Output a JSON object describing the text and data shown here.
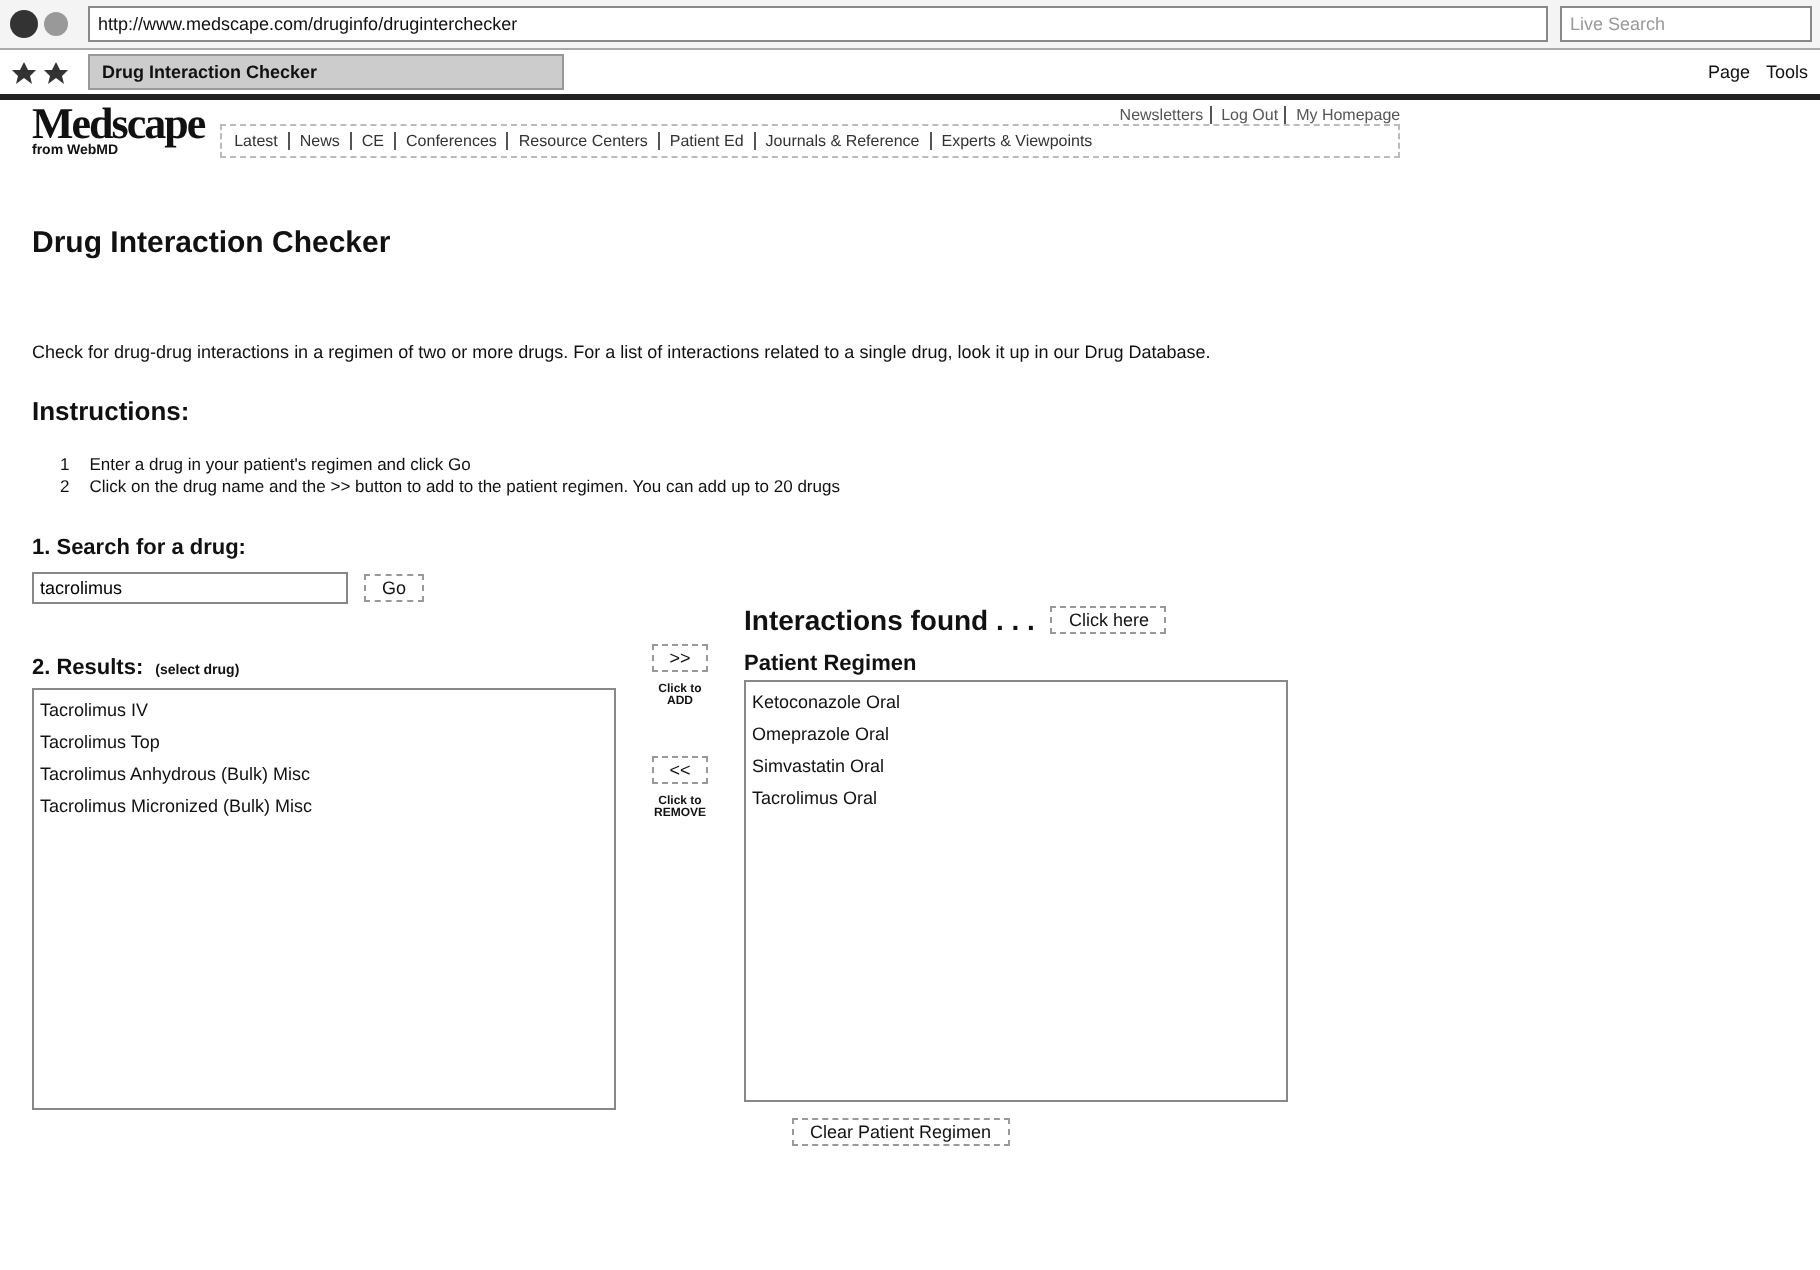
{
  "browser": {
    "address": "http://www.medscape.com/druginfo/druginterchecker",
    "search_placeholder": "Live Search",
    "tab_title": "Drug Interaction Checker",
    "toolbar": [
      "Page",
      "Tools"
    ]
  },
  "header": {
    "logo": "Medscape",
    "logo_sub": "from WebMD",
    "top_links": [
      "Newsletters",
      "Log Out",
      "My Homepage"
    ],
    "nav": [
      "Latest",
      "News",
      "CE",
      "Conferences",
      "Resource Centers",
      "Patient Ed",
      "Journals & Reference",
      "Experts & Viewpoints"
    ]
  },
  "title": "Drug Interaction Checker",
  "intro": "Check for drug-drug interactions in a regimen of two or more drugs. For a list of interactions related to a single drug, look it up in our Drug Database.",
  "instructions_heading": "Instructions:",
  "instructions": [
    {
      "number": "1",
      "text": "Enter a drug in your patient's regimen and click Go"
    },
    {
      "number": "2",
      "text": "Click on the drug name and the >> button to add to the patient regimen. You can add up to 20 drugs"
    }
  ],
  "search": {
    "label": "1. Search for a drug:",
    "value": "tacrolimus",
    "button": "Go"
  },
  "interactions": {
    "label": "Interactions found . . .",
    "button": "Click here"
  },
  "results": {
    "label": "2. Results:",
    "hint": "(select drug)",
    "items": [
      {
        "text": "Tacrolimus IV",
        "selected": false
      },
      {
        "text": "Tacrolimus Top",
        "selected": false
      },
      {
        "text": "Tacrolimus Anhydrous (Bulk) Misc",
        "selected": false
      },
      {
        "text": "Tacrolimus Micronized (Bulk) Misc",
        "selected": false
      }
    ]
  },
  "add": {
    "button": ">>",
    "caption": "Click to ADD"
  },
  "remove": {
    "button": "<<",
    "caption": "Click to REMOVE"
  },
  "regimen": {
    "label": "Patient Regimen",
    "items": [
      {
        "text": "Ketoconazole Oral",
        "selected": false
      },
      {
        "text": "Omeprazole Oral",
        "selected": false
      },
      {
        "text": "Simvastatin Oral",
        "selected": false
      },
      {
        "text": "Tacrolimus Oral",
        "selected": false
      }
    ]
  },
  "clear_button": "Clear Patient Regimen"
}
